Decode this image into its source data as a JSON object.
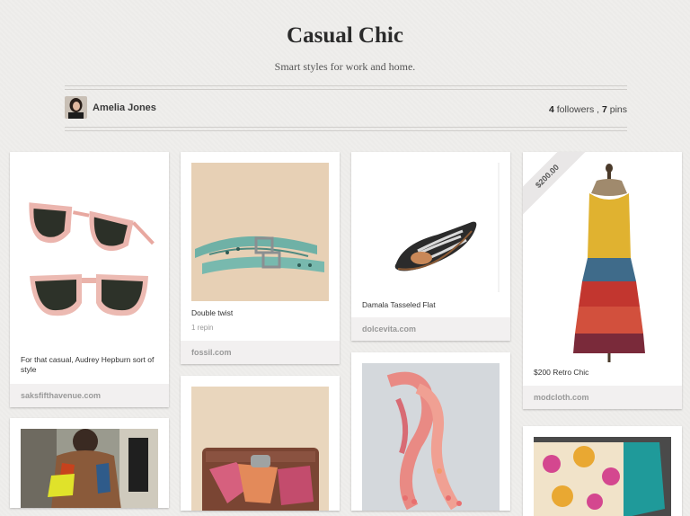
{
  "board": {
    "title": "Casual Chic",
    "description": "Smart styles for work and home."
  },
  "owner": {
    "name": "Amelia Jones",
    "followers_count": "4",
    "followers_label": "followers",
    "separator": ",",
    "pins_count": "7",
    "pins_label": "pins"
  },
  "pins": [
    {
      "description": "For that casual, Audrey Hepburn sort of style",
      "source": "saksfifthavenue.com"
    },
    {
      "description": "Double twist",
      "repins": "1 repin",
      "source": "fossil.com"
    },
    {
      "description": "Damala Tasseled Flat",
      "source": "dolcevita.com"
    },
    {
      "price": "$200.00",
      "description": "$200 Retro Chic",
      "source": "modcloth.com"
    }
  ],
  "colors": {
    "background": "#efeeec",
    "card": "#ffffff",
    "source_bar": "#f2f0f0"
  }
}
